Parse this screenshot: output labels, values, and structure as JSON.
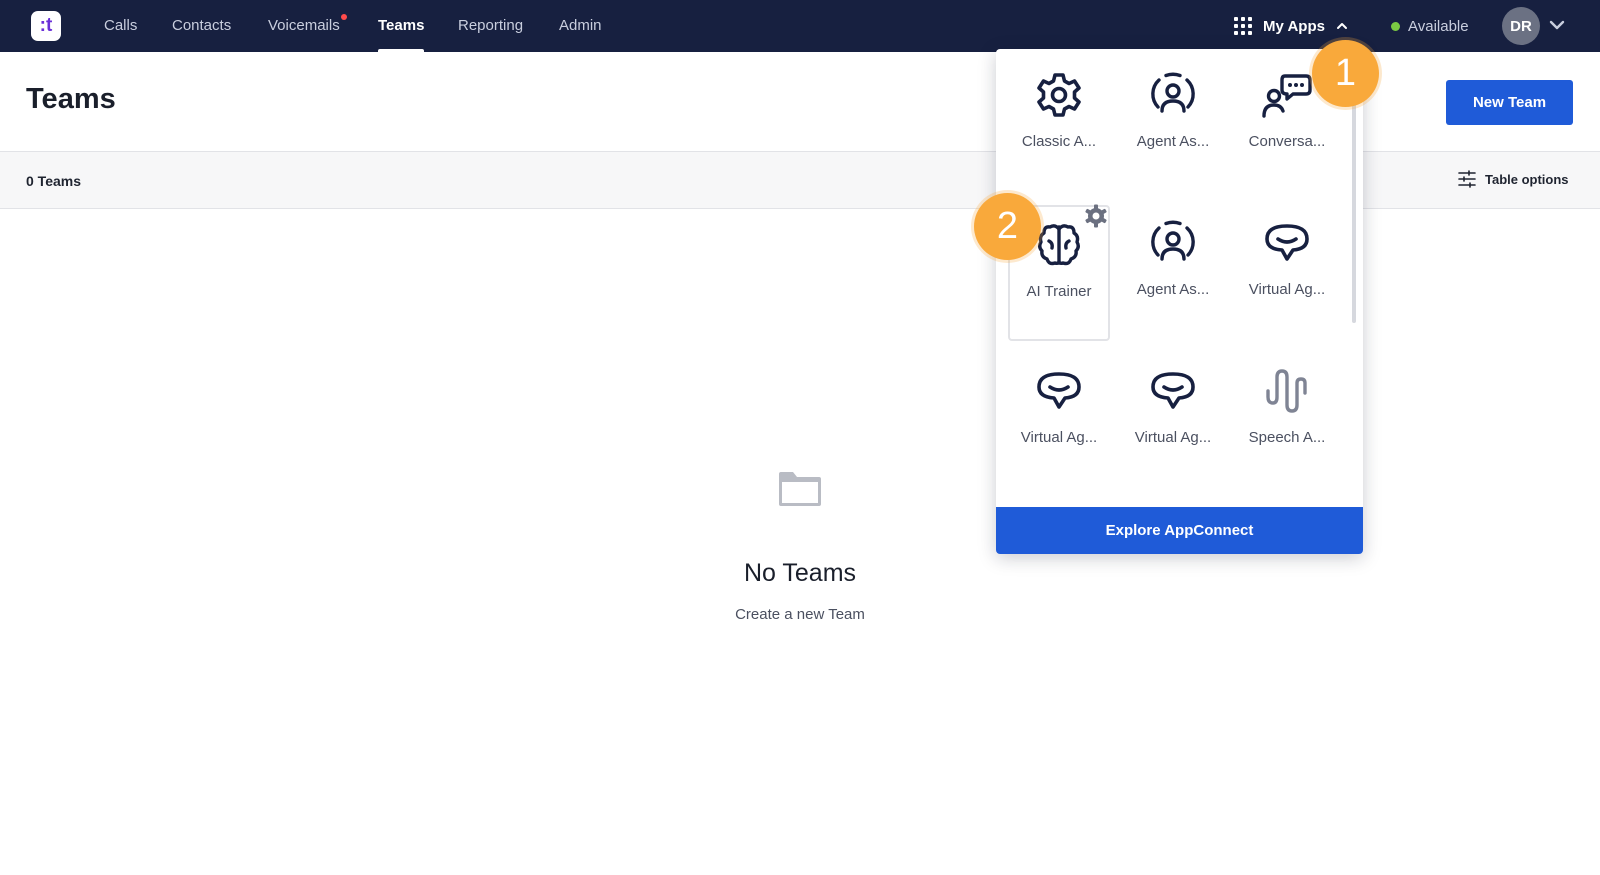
{
  "nav": {
    "logo_text": ":t",
    "items": [
      {
        "label": "Calls"
      },
      {
        "label": "Contacts"
      },
      {
        "label": "Voicemails"
      },
      {
        "label": "Teams"
      },
      {
        "label": "Reporting"
      },
      {
        "label": "Admin"
      }
    ],
    "active": "Teams",
    "my_apps_label": "My Apps",
    "status_label": "Available",
    "status_color": "#7bc943",
    "avatar_initials": "DR"
  },
  "page": {
    "title": "Teams",
    "new_button_label": "New Team",
    "count_label": "0 Teams",
    "table_options_label": "Table options",
    "empty_title": "No Teams",
    "empty_subtitle": "Create a new Team"
  },
  "apps_menu": {
    "apps": [
      {
        "label": "Classic A...",
        "icon": "gear-icon"
      },
      {
        "label": "Agent As...",
        "icon": "agent-icon"
      },
      {
        "label": "Conversa...",
        "icon": "conversation-icon"
      },
      {
        "label": "AI Trainer",
        "icon": "brain-icon"
      },
      {
        "label": "Agent As...",
        "icon": "agent-icon"
      },
      {
        "label": "Virtual Ag...",
        "icon": "chat-bubble-icon"
      },
      {
        "label": "Virtual Ag...",
        "icon": "chat-bubble-icon"
      },
      {
        "label": "Virtual Ag...",
        "icon": "chat-bubble-icon"
      },
      {
        "label": "Speech A...",
        "icon": "waveform-icon"
      }
    ],
    "selected_app": "AI Trainer",
    "explore_label": "Explore AppConnect"
  },
  "callouts": [
    {
      "number": "1"
    },
    {
      "number": "2"
    }
  ],
  "colors": {
    "nav_bg": "#172040",
    "primary": "#1f5bd8",
    "callout": "#f9a93b",
    "icon_dark": "#172040"
  }
}
